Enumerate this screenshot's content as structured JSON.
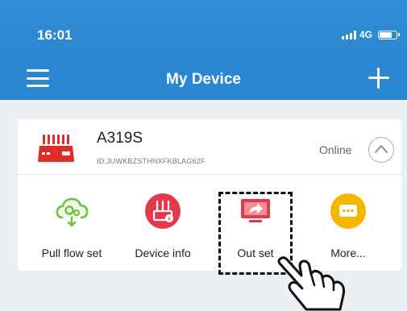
{
  "status_bar": {
    "time": "16:01",
    "network": "4G"
  },
  "nav": {
    "title": "My Device",
    "menu_icon": "hamburger-menu-icon",
    "add_icon": "plus-icon"
  },
  "device": {
    "name": "A319S",
    "id": "ID:JUWKBZSTHNXFKBLAG62F",
    "status": "Online",
    "icon": "router-icon",
    "collapse_icon": "chevron-up-icon"
  },
  "actions": [
    {
      "label": "Pull flow set",
      "icon": "cloud-settings-icon",
      "color": "#7ac943"
    },
    {
      "label": "Device info",
      "icon": "router-info-icon",
      "color": "#e5384c"
    },
    {
      "label": "Out set",
      "icon": "screen-share-icon",
      "color": "#ffffff"
    },
    {
      "label": "More...",
      "icon": "more-dots-icon",
      "color": "#f7b500"
    }
  ],
  "colors": {
    "header": "#2a86d0",
    "background": "#eceff3",
    "accent_red": "#e5384c"
  }
}
